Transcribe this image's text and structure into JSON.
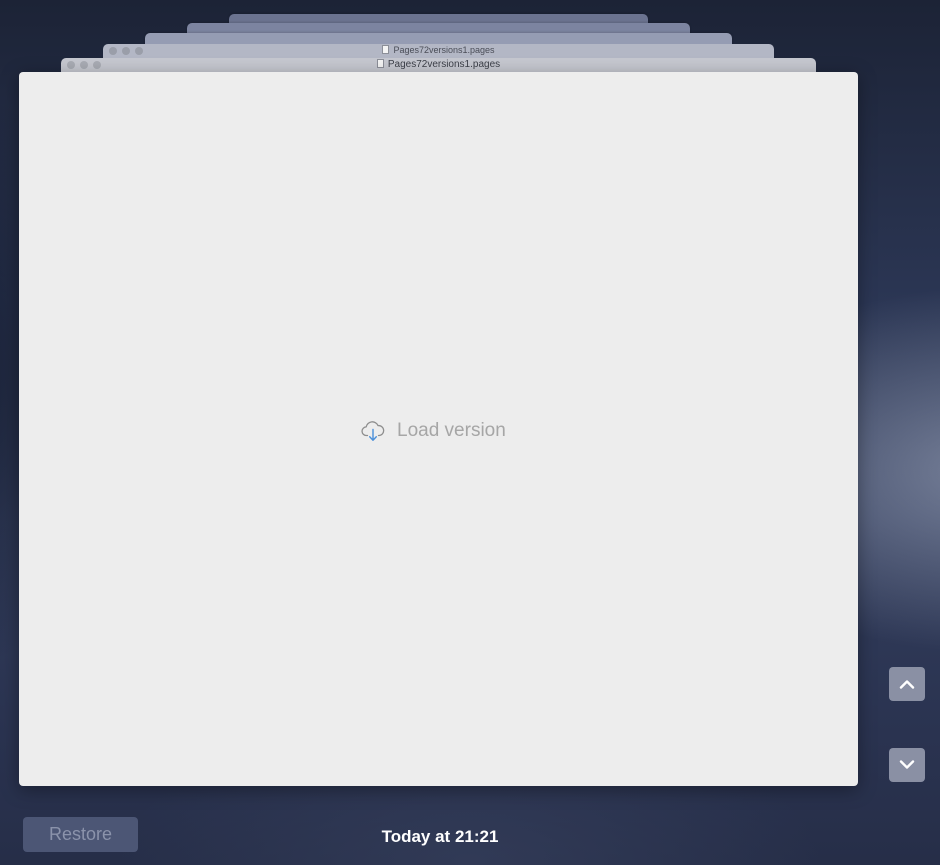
{
  "stacked_windows": [
    {
      "title": "Pages72versions1.pages"
    },
    {
      "title": "Pages72versions1.pages"
    }
  ],
  "main": {
    "load_label": "Load version",
    "cloud_icon": "cloud-download-icon",
    "accent_color": "#4a8fd9"
  },
  "navigation": {
    "up_icon": "chevron-up-icon",
    "down_icon": "chevron-down-icon"
  },
  "footer": {
    "restore_label": "Restore",
    "timestamp": "Today at 21:21"
  }
}
